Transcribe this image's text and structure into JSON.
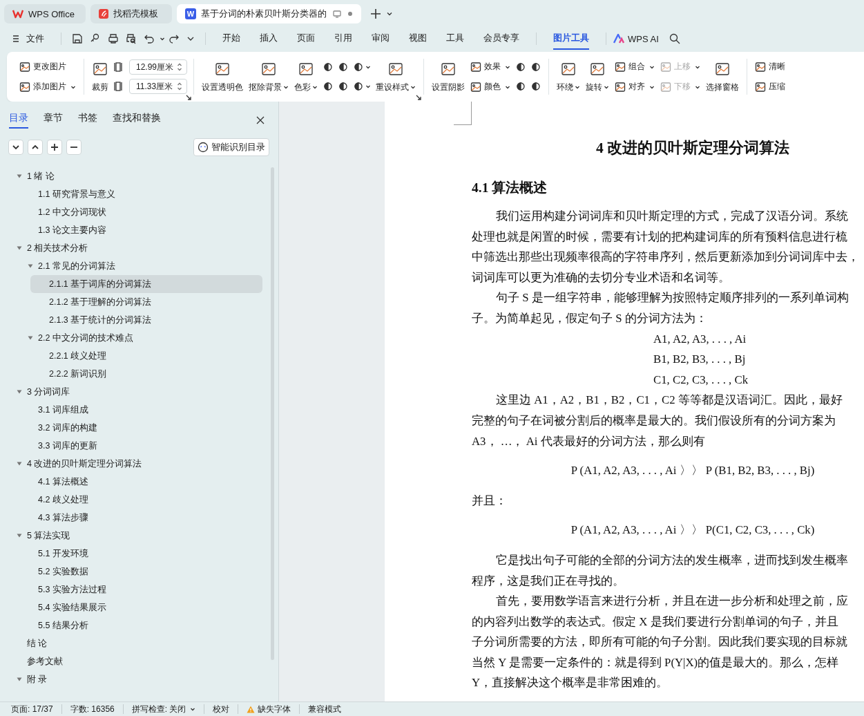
{
  "tabs": [
    {
      "kind": "home",
      "label": "WPS Office",
      "selected": false
    },
    {
      "kind": "template",
      "label": "找稻壳模板",
      "selected": false
    },
    {
      "kind": "document",
      "badge": "W",
      "label": "基于分词的朴素贝叶斯分类器的",
      "selected": true,
      "unsaved": true
    }
  ],
  "menu": {
    "file_label": "文件",
    "items": [
      {
        "label": "开始",
        "selected": false
      },
      {
        "label": "插入",
        "selected": false
      },
      {
        "label": "页面",
        "selected": false
      },
      {
        "label": "引用",
        "selected": false
      },
      {
        "label": "审阅",
        "selected": false
      },
      {
        "label": "视图",
        "selected": false
      },
      {
        "label": "工具",
        "selected": false
      },
      {
        "label": "会员专享",
        "selected": false
      },
      {
        "label": "图片工具",
        "selected": true
      }
    ],
    "ai_label": "WPS AI"
  },
  "ribbon": {
    "groups": [
      {
        "columns": [
          [
            {
              "kind": "small",
              "label": "更改图片"
            },
            {
              "kind": "small",
              "label": "添加图片",
              "dropdown": true
            }
          ]
        ]
      },
      {
        "launcher": true,
        "columns": [
          [
            {
              "kind": "large",
              "label": "裁剪"
            }
          ],
          [
            {
              "kind": "field",
              "value": "12.99厘米"
            },
            {
              "kind": "field",
              "value": "11.33厘米"
            }
          ]
        ]
      },
      {
        "launcher": true,
        "columns": [
          [
            {
              "kind": "large",
              "label": "设置透明色"
            }
          ],
          [
            {
              "kind": "large",
              "label": "抠除背景",
              "dropdown": true
            }
          ],
          [
            {
              "kind": "large",
              "label": "色彩",
              "dropdown": true
            }
          ],
          [
            {
              "kind": "icon"
            },
            {
              "kind": "icon"
            }
          ],
          [
            {
              "kind": "icon"
            },
            {
              "kind": "icon"
            }
          ],
          [
            {
              "kind": "icon",
              "dropdown": true
            },
            {
              "kind": "icon",
              "dropdown": true
            }
          ],
          [
            {
              "kind": "large",
              "label": "重设样式",
              "dropdown": true
            }
          ]
        ]
      },
      {
        "columns": [
          [
            {
              "kind": "large",
              "label": "设置阴影"
            }
          ],
          [
            {
              "kind": "small",
              "label": "效果",
              "dropdown": true
            },
            {
              "kind": "small",
              "label": "颜色",
              "dropdown": true
            }
          ],
          [
            {
              "kind": "icon"
            },
            {
              "kind": "icon"
            }
          ],
          [
            {
              "kind": "icon"
            },
            {
              "kind": "icon"
            }
          ]
        ]
      },
      {
        "columns": [
          [
            {
              "kind": "large",
              "label": "环绕",
              "dropdown": true
            }
          ],
          [
            {
              "kind": "large",
              "label": "旋转",
              "dropdown": true
            }
          ],
          [
            {
              "kind": "small",
              "label": "组合",
              "dropdown": true
            },
            {
              "kind": "small",
              "label": "对齐",
              "dropdown": true
            }
          ],
          [
            {
              "kind": "small",
              "label": "上移",
              "dropdown": true,
              "disabled": true
            },
            {
              "kind": "small",
              "label": "下移",
              "dropdown": true,
              "disabled": true
            }
          ],
          [
            {
              "kind": "large",
              "label": "选择窗格"
            }
          ]
        ]
      },
      {
        "columns": [
          [
            {
              "kind": "small",
              "label": "清晰"
            },
            {
              "kind": "small",
              "label": "压缩"
            }
          ]
        ]
      }
    ]
  },
  "sidebar": {
    "tabs": [
      {
        "label": "目录",
        "selected": true
      },
      {
        "label": "章节",
        "selected": false
      },
      {
        "label": "书签",
        "selected": false
      },
      {
        "label": "查找和替换",
        "selected": false
      }
    ],
    "smart_button": "智能识别目录",
    "outline": [
      {
        "label": "1  绪  论",
        "expanded": true,
        "selected": false,
        "children": [
          {
            "label": "1.1 研究背景与意义",
            "selected": false
          },
          {
            "label": "1.2 中文分词现状",
            "selected": false
          },
          {
            "label": "1.3  论文主要内容",
            "selected": false
          }
        ]
      },
      {
        "label": "2 相关技术分析",
        "expanded": true,
        "selected": false,
        "children": [
          {
            "label": "2.1 常见的分词算法",
            "expanded": true,
            "selected": false,
            "children": [
              {
                "label": "2.1.1 基于词库的分词算法",
                "selected": true
              },
              {
                "label": "2.1.2 基于理解的分词算法",
                "selected": false
              },
              {
                "label": "2.1.3 基于统计的分词算法",
                "selected": false
              }
            ]
          },
          {
            "label": "2.2 中文分词的技术难点",
            "expanded": true,
            "selected": false,
            "children": [
              {
                "label": "2.2.1 歧义处理",
                "selected": false
              },
              {
                "label": "2.2.2 新词识别",
                "selected": false
              }
            ]
          }
        ]
      },
      {
        "label": "3 分词词库",
        "expanded": true,
        "selected": false,
        "children": [
          {
            "label": "3.1 词库组成",
            "selected": false
          },
          {
            "label": "3.2  词库的构建",
            "selected": false
          },
          {
            "label": "3.3  词库的更新",
            "selected": false
          }
        ]
      },
      {
        "label": "4  改进的贝叶斯定理分词算法",
        "expanded": true,
        "selected": false,
        "children": [
          {
            "label": "4.1  算法概述",
            "selected": false
          },
          {
            "label": "4.2  歧义处理",
            "selected": false
          },
          {
            "label": "4.3  算法步骤",
            "selected": false
          }
        ]
      },
      {
        "label": "5  算法实现",
        "expanded": true,
        "selected": false,
        "children": [
          {
            "label": "5.1  开发环境",
            "selected": false
          },
          {
            "label": "5.2  实验数据",
            "selected": false
          },
          {
            "label": "5.3  实验方法过程",
            "selected": false
          },
          {
            "label": "5.4  实验结果展示",
            "selected": false
          },
          {
            "label": "5.5 结果分析",
            "selected": false
          }
        ]
      },
      {
        "label": "结  论",
        "selected": false
      },
      {
        "label": "参考文献",
        "selected": false
      },
      {
        "label": "附  录",
        "expanded": true,
        "selected": false
      }
    ]
  },
  "document": {
    "heading": "4  改进的贝叶斯定理分词算法",
    "section": "4.1  算法概述",
    "blocks": [
      {
        "kind": "para",
        "lines": [
          "我们运用构建分词词库和贝叶斯定理的方式，完成了汉语分词。系统",
          "处理也就是闲置的时候，需要有计划的把构建词库的所有预料信息进行梳",
          "中筛选出那些出现频率很高的字符串序列，然后更新添加到分词词库中去，",
          "词词库可以更为准确的去切分专业术语和名词等。"
        ]
      },
      {
        "kind": "para",
        "lines": [
          "句子 S 是一组字符串，能够理解为按照特定顺序排列的一系列单词构",
          "子。为简单起见，假定句子 S 的分词方法为："
        ]
      },
      {
        "kind": "formulas",
        "lines": [
          "A1, A2, A3, . . . , Ai",
          "B1, B2, B3, . . . , Bj",
          "C1, C2, C3, . . . , Ck"
        ]
      },
      {
        "kind": "para",
        "lines": [
          "这里边 A1，A2，B1，B2，C1，C2 等等都是汉语词汇。因此，最好",
          "完整的句子在词被分割后的概率是最大的。我们假设所有的分词方案为",
          "A3，  …，  Ai 代表最好的分词方法，那么则有"
        ]
      },
      {
        "kind": "equation",
        "text": "P (A1, A2, A3, . . . , Ai 〉〉 P (B1, B2, B3, . . . , Bj)"
      },
      {
        "kind": "plain",
        "text": "并且："
      },
      {
        "kind": "equation",
        "text": "P (A1, A2, A3, . . . , Ai 〉〉  P(C1, C2, C3, . . . , Ck)"
      },
      {
        "kind": "para",
        "lines": [
          "它是找出句子可能的全部的分词方法的发生概率，进而找到发生概率",
          "程序，这是我们正在寻找的。"
        ]
      },
      {
        "kind": "para",
        "lines": [
          "首先，要用数学语言来进行分析，并且在进一步分析和处理之前，应",
          "的内容列出数学的表达式。假定 X 是我们要进行分割单词的句子，并且",
          "子分词所需要的方法，即所有可能的句子分割。因此我们要实现的目标就",
          "当然 Y 是需要一定条件的：就是得到 P(Y|X)的值是最大的。那么，怎样",
          "Y，直接解决这个概率是非常困难的。"
        ]
      }
    ]
  },
  "status_bar": [
    {
      "kind": "text",
      "text": "页面: 17/37"
    },
    {
      "kind": "text",
      "text": "字数: 16356"
    },
    {
      "kind": "dropdown",
      "text": "拼写检查: 关闭"
    },
    {
      "kind": "button",
      "text": "校对"
    },
    {
      "kind": "warning",
      "text": "缺失字体"
    },
    {
      "kind": "text",
      "text": "兼容模式"
    }
  ]
}
